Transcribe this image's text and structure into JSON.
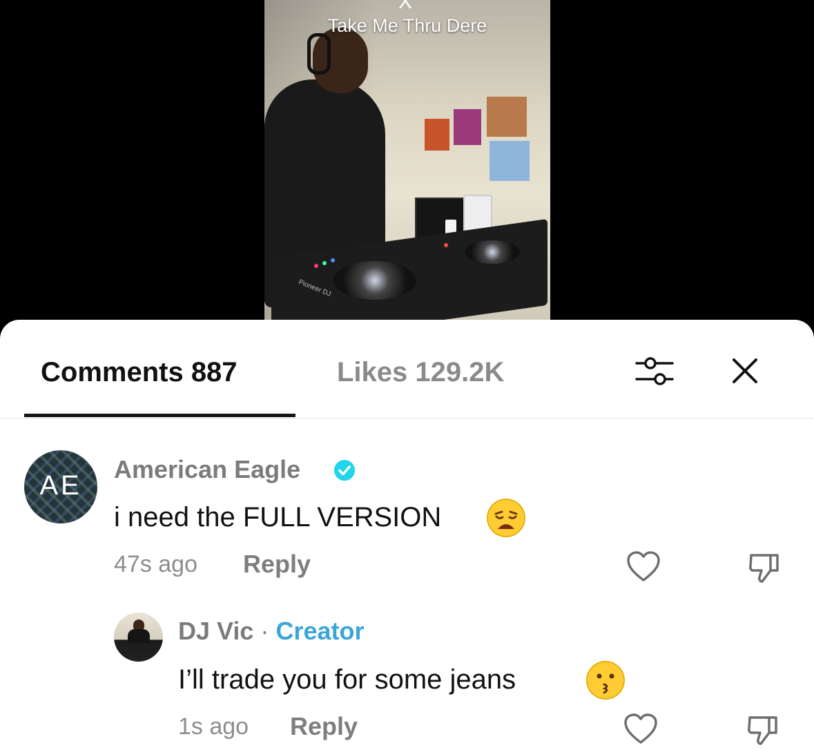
{
  "video": {
    "caption": "Take Me Thru Dere",
    "close_glyph": "X",
    "controller_brand": "Pioneer DJ"
  },
  "tabs": {
    "comments_label": "Comments 887",
    "likes_label": "Likes 129.2K",
    "active": "comments"
  },
  "toolbar": {
    "filter_icon": "sliders-icon",
    "close_icon": "close-icon"
  },
  "comments": [
    {
      "avatar_text": "AE",
      "username": "American Eagle",
      "verified": true,
      "text": "i need the FULL VERSION",
      "emoji": "weary-face",
      "time": "47s ago",
      "reply_label": "Reply"
    },
    {
      "username": "DJ Vic",
      "separator": "·",
      "role": "Creator",
      "text": "I’ll trade you for some jeans",
      "emoji": "kissing-face",
      "time": "1s ago",
      "reply_label": "Reply"
    }
  ],
  "colors": {
    "accent_creator": "#3aa6d8",
    "verified_badge": "#20d5ec",
    "text_primary": "#111111",
    "text_secondary": "#8d8d8d"
  }
}
